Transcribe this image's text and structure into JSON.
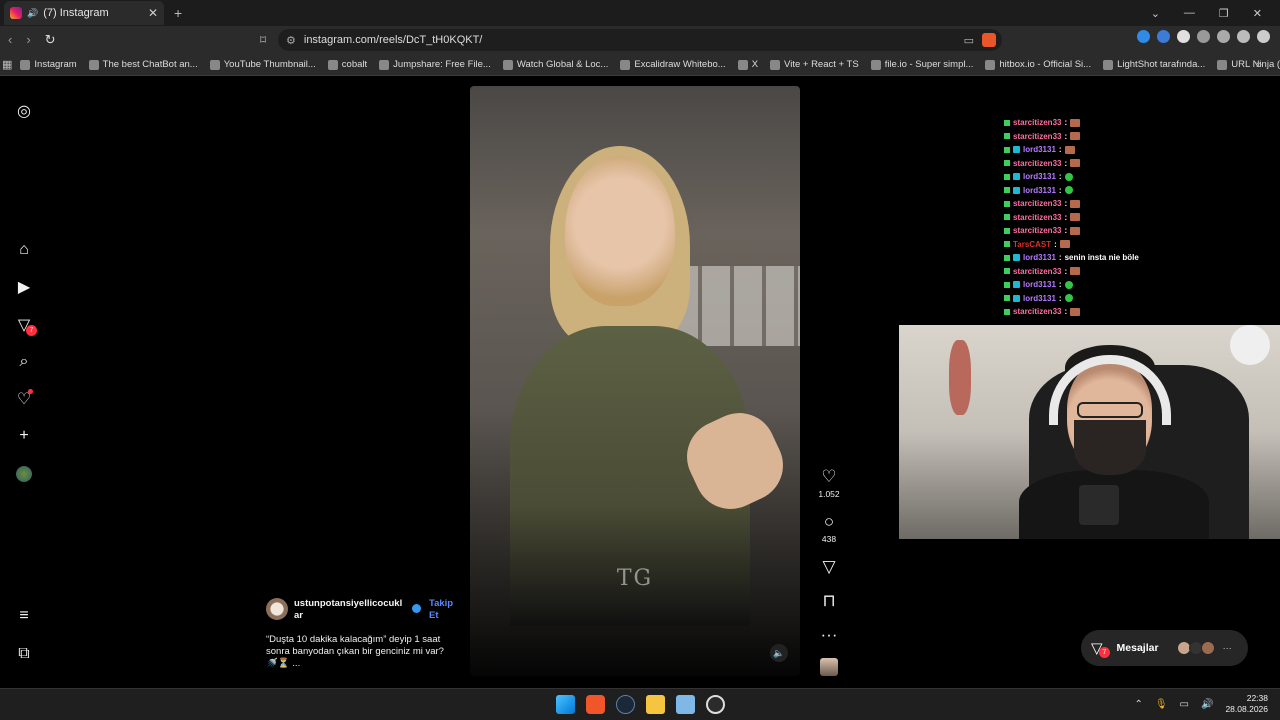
{
  "browser": {
    "tab_title": "(7) Instagram",
    "tab_close": "✕",
    "new_tab": "+",
    "url": "instagram.com/reels/DcT_tH0KQKT/",
    "bookmarks": [
      "Instagram",
      "The best ChatBot an...",
      "YouTube Thumbnail...",
      "cobalt",
      "Jumpshare: Free File...",
      "Watch Global & Loc...",
      "Excalidraw Whitebo...",
      "X",
      "Vite + React + TS",
      "file.io - Super simpl...",
      "hitbox.io - Official Si...",
      "LightShot tarafında...",
      "URL Ninja (1)"
    ]
  },
  "sidebar": {
    "messages_badge": "7"
  },
  "reel": {
    "watermark": "TG",
    "likes": "1.052",
    "comments": "438",
    "author": "ustunpotansiyellicocuklar",
    "follow_label": "Takip Et",
    "caption": "“Duşta 10 dakika kalacağım” deyip 1 saat sonra banyodan çıkan bir genciniz mi var? 🚿⏳ ..."
  },
  "chat": [
    {
      "user": "starcitizen33",
      "color": "#ff6fa0",
      "emote": "brown",
      "badges": 1
    },
    {
      "user": "starcitizen33",
      "color": "#ff6fa0",
      "emote": "brown",
      "badges": 1
    },
    {
      "user": "lord3131",
      "color": "#b57bff",
      "emote": "brown",
      "badges": 2
    },
    {
      "user": "starcitizen33",
      "color": "#ff6fa0",
      "emote": "brown",
      "badges": 1
    },
    {
      "user": "lord3131",
      "color": "#b57bff",
      "emote": "green",
      "badges": 2
    },
    {
      "user": "lord3131",
      "color": "#b57bff",
      "emote": "green",
      "badges": 2
    },
    {
      "user": "starcitizen33",
      "color": "#ff6fa0",
      "emote": "brown",
      "badges": 1
    },
    {
      "user": "starcitizen33",
      "color": "#ff6fa0",
      "emote": "brown",
      "badges": 1
    },
    {
      "user": "starcitizen33",
      "color": "#ff6fa0",
      "emote": "brown",
      "badges": 1
    },
    {
      "user": "TarsCAST",
      "color": "#e0302a",
      "emote": "brown",
      "badges": 1
    },
    {
      "user": "lord3131",
      "color": "#b57bff",
      "text": "senin insta nie böle",
      "badges": 2
    },
    {
      "user": "starcitizen33",
      "color": "#ff6fa0",
      "emote": "brown",
      "badges": 1
    },
    {
      "user": "lord3131",
      "color": "#b57bff",
      "emote": "green",
      "badges": 2
    },
    {
      "user": "lord3131",
      "color": "#b57bff",
      "emote": "green",
      "badges": 2
    },
    {
      "user": "starcitizen33",
      "color": "#ff6fa0",
      "emote": "brown",
      "badges": 1
    }
  ],
  "messages": {
    "label": "Mesajlar",
    "badge": "7",
    "more": "···"
  },
  "taskbar": {
    "time": "22:38",
    "date": "28.08.2026"
  },
  "colors": {
    "accent": "#5b87ff",
    "notification": "#ff3040",
    "background": "#000000"
  }
}
